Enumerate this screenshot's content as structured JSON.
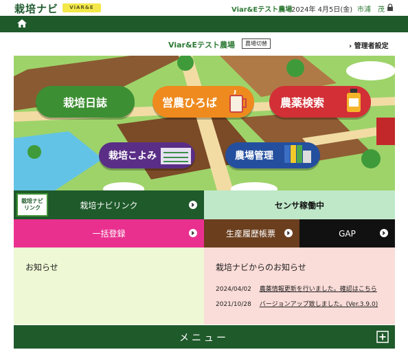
{
  "header": {
    "logo": "栽培ナビ",
    "logo_badge": "ViAR&E",
    "farm": "Viar&Eテスト農場",
    "date": "2024年 4月5日(金)",
    "user": "市浦　茂"
  },
  "subheader": {
    "farm_name": "Viar&Eテスト農場",
    "switch_button": "農場切替",
    "admin_link": "管理者設定"
  },
  "hero": {
    "buttons": {
      "diary": "栽培日誌",
      "plaza": "営農ひろば",
      "pesticide": "農薬検索",
      "calendar": "栽培こよみ",
      "farm_mgmt": "農場管理"
    }
  },
  "tiles": {
    "navi_link_icon": "栽培ナビ リンク",
    "navi_link": "栽培ナビリンク",
    "sensor": "センサ稼働中",
    "bulk": "一括登録",
    "history": "生産履歴帳票",
    "gap": "GAP"
  },
  "news": {
    "left_title": "お知らせ",
    "right_title": "栽培ナビからのお知らせ",
    "items": [
      {
        "date": "2024/04/02",
        "text": "農薬情報更新を行いました。確認はこちら"
      },
      {
        "date": "2021/10/28",
        "text": "バージョンアップ致しました。(Ver.3.9.0)"
      }
    ]
  },
  "menu": {
    "label": "メニュー"
  },
  "colors": {
    "dark_green": "#1f5a2b",
    "light_green": "#bfe8c9",
    "pink": "#e9308f",
    "brown": "#6b3e1d",
    "black": "#111111"
  }
}
